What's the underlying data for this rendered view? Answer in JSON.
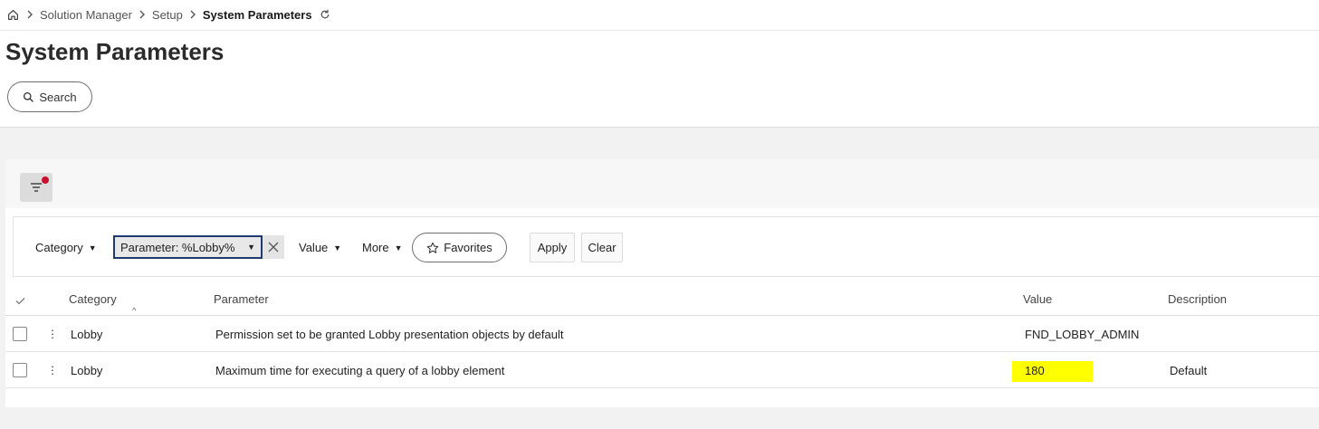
{
  "breadcrumb": {
    "items": [
      "Solution Manager",
      "Setup"
    ],
    "current": "System Parameters"
  },
  "page": {
    "title": "System Parameters"
  },
  "search": {
    "label": "Search"
  },
  "criteria": {
    "category_label": "Category",
    "parameter_chip": "Parameter: %Lobby%",
    "value_label": "Value",
    "more_label": "More",
    "favorites_label": "Favorites",
    "apply_label": "Apply",
    "clear_label": "Clear"
  },
  "table": {
    "columns": [
      "Category",
      "Parameter",
      "Value",
      "Description"
    ],
    "rows": [
      {
        "category": "Lobby",
        "parameter": "Permission set to be granted Lobby presentation objects by default",
        "value": "FND_LOBBY_ADMIN",
        "description": ""
      },
      {
        "category": "Lobby",
        "parameter": "Maximum time for executing a query of a lobby element",
        "value": "180",
        "description": "Default"
      }
    ]
  },
  "colors": {
    "highlight": "#ffff00",
    "filter_dot": "#c8102e",
    "chip_border": "#1f3a6e"
  },
  "icons": [
    "home-icon",
    "chevron-right-icon",
    "refresh-icon",
    "search-icon",
    "filter-icon",
    "close-icon",
    "star-icon",
    "check-icon",
    "sort-up-icon",
    "kebab-icon"
  ]
}
